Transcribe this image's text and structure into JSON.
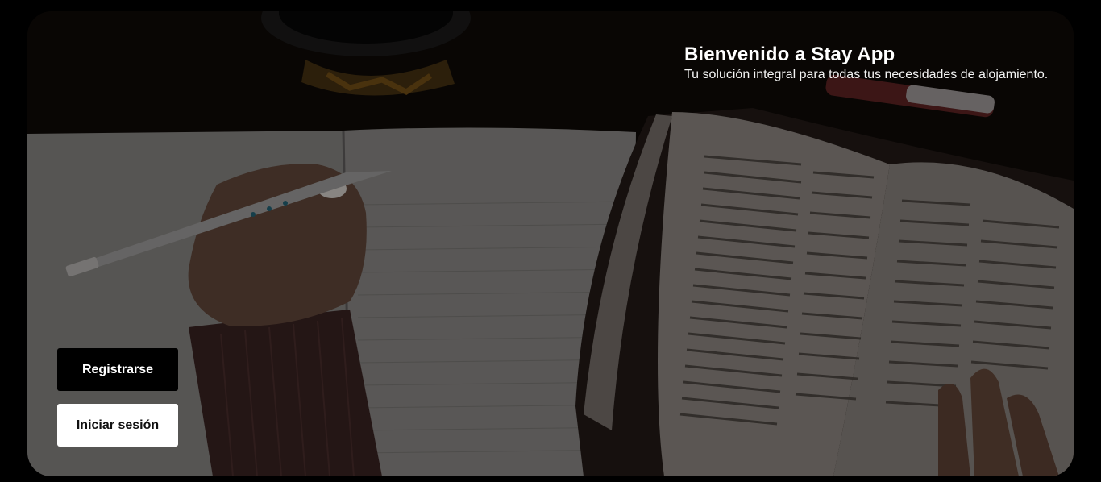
{
  "hero": {
    "title": "Bienvenido a Stay App",
    "subtitle": "Tu solución integral para todas tus necesidades de alojamiento.",
    "image_description": "desk-with-notebook-pen-and-open-book"
  },
  "actions": {
    "register_label": "Registrarse",
    "login_label": "Iniciar sesión"
  },
  "colors": {
    "page_background": "#000000",
    "register_button_bg": "#000000",
    "login_button_bg": "#ffffff"
  }
}
